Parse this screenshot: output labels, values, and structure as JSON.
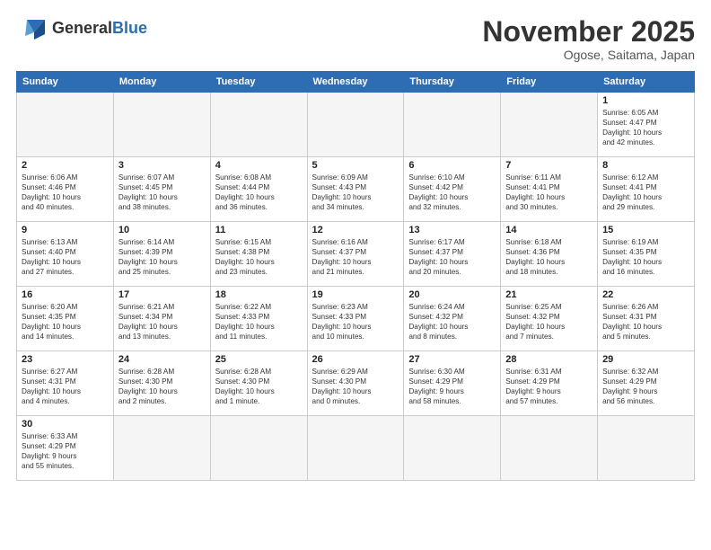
{
  "header": {
    "logo_general": "General",
    "logo_blue": "Blue",
    "month_title": "November 2025",
    "subtitle": "Ogose, Saitama, Japan"
  },
  "weekdays": [
    "Sunday",
    "Monday",
    "Tuesday",
    "Wednesday",
    "Thursday",
    "Friday",
    "Saturday"
  ],
  "weeks": [
    [
      {
        "day": "",
        "info": ""
      },
      {
        "day": "",
        "info": ""
      },
      {
        "day": "",
        "info": ""
      },
      {
        "day": "",
        "info": ""
      },
      {
        "day": "",
        "info": ""
      },
      {
        "day": "",
        "info": ""
      },
      {
        "day": "1",
        "info": "Sunrise: 6:05 AM\nSunset: 4:47 PM\nDaylight: 10 hours\nand 42 minutes."
      }
    ],
    [
      {
        "day": "2",
        "info": "Sunrise: 6:06 AM\nSunset: 4:46 PM\nDaylight: 10 hours\nand 40 minutes."
      },
      {
        "day": "3",
        "info": "Sunrise: 6:07 AM\nSunset: 4:45 PM\nDaylight: 10 hours\nand 38 minutes."
      },
      {
        "day": "4",
        "info": "Sunrise: 6:08 AM\nSunset: 4:44 PM\nDaylight: 10 hours\nand 36 minutes."
      },
      {
        "day": "5",
        "info": "Sunrise: 6:09 AM\nSunset: 4:43 PM\nDaylight: 10 hours\nand 34 minutes."
      },
      {
        "day": "6",
        "info": "Sunrise: 6:10 AM\nSunset: 4:42 PM\nDaylight: 10 hours\nand 32 minutes."
      },
      {
        "day": "7",
        "info": "Sunrise: 6:11 AM\nSunset: 4:41 PM\nDaylight: 10 hours\nand 30 minutes."
      },
      {
        "day": "8",
        "info": "Sunrise: 6:12 AM\nSunset: 4:41 PM\nDaylight: 10 hours\nand 29 minutes."
      }
    ],
    [
      {
        "day": "9",
        "info": "Sunrise: 6:13 AM\nSunset: 4:40 PM\nDaylight: 10 hours\nand 27 minutes."
      },
      {
        "day": "10",
        "info": "Sunrise: 6:14 AM\nSunset: 4:39 PM\nDaylight: 10 hours\nand 25 minutes."
      },
      {
        "day": "11",
        "info": "Sunrise: 6:15 AM\nSunset: 4:38 PM\nDaylight: 10 hours\nand 23 minutes."
      },
      {
        "day": "12",
        "info": "Sunrise: 6:16 AM\nSunset: 4:37 PM\nDaylight: 10 hours\nand 21 minutes."
      },
      {
        "day": "13",
        "info": "Sunrise: 6:17 AM\nSunset: 4:37 PM\nDaylight: 10 hours\nand 20 minutes."
      },
      {
        "day": "14",
        "info": "Sunrise: 6:18 AM\nSunset: 4:36 PM\nDaylight: 10 hours\nand 18 minutes."
      },
      {
        "day": "15",
        "info": "Sunrise: 6:19 AM\nSunset: 4:35 PM\nDaylight: 10 hours\nand 16 minutes."
      }
    ],
    [
      {
        "day": "16",
        "info": "Sunrise: 6:20 AM\nSunset: 4:35 PM\nDaylight: 10 hours\nand 14 minutes."
      },
      {
        "day": "17",
        "info": "Sunrise: 6:21 AM\nSunset: 4:34 PM\nDaylight: 10 hours\nand 13 minutes."
      },
      {
        "day": "18",
        "info": "Sunrise: 6:22 AM\nSunset: 4:33 PM\nDaylight: 10 hours\nand 11 minutes."
      },
      {
        "day": "19",
        "info": "Sunrise: 6:23 AM\nSunset: 4:33 PM\nDaylight: 10 hours\nand 10 minutes."
      },
      {
        "day": "20",
        "info": "Sunrise: 6:24 AM\nSunset: 4:32 PM\nDaylight: 10 hours\nand 8 minutes."
      },
      {
        "day": "21",
        "info": "Sunrise: 6:25 AM\nSunset: 4:32 PM\nDaylight: 10 hours\nand 7 minutes."
      },
      {
        "day": "22",
        "info": "Sunrise: 6:26 AM\nSunset: 4:31 PM\nDaylight: 10 hours\nand 5 minutes."
      }
    ],
    [
      {
        "day": "23",
        "info": "Sunrise: 6:27 AM\nSunset: 4:31 PM\nDaylight: 10 hours\nand 4 minutes."
      },
      {
        "day": "24",
        "info": "Sunrise: 6:28 AM\nSunset: 4:30 PM\nDaylight: 10 hours\nand 2 minutes."
      },
      {
        "day": "25",
        "info": "Sunrise: 6:28 AM\nSunset: 4:30 PM\nDaylight: 10 hours\nand 1 minute."
      },
      {
        "day": "26",
        "info": "Sunrise: 6:29 AM\nSunset: 4:30 PM\nDaylight: 10 hours\nand 0 minutes."
      },
      {
        "day": "27",
        "info": "Sunrise: 6:30 AM\nSunset: 4:29 PM\nDaylight: 9 hours\nand 58 minutes."
      },
      {
        "day": "28",
        "info": "Sunrise: 6:31 AM\nSunset: 4:29 PM\nDaylight: 9 hours\nand 57 minutes."
      },
      {
        "day": "29",
        "info": "Sunrise: 6:32 AM\nSunset: 4:29 PM\nDaylight: 9 hours\nand 56 minutes."
      }
    ],
    [
      {
        "day": "30",
        "info": "Sunrise: 6:33 AM\nSunset: 4:29 PM\nDaylight: 9 hours\nand 55 minutes."
      },
      {
        "day": "",
        "info": ""
      },
      {
        "day": "",
        "info": ""
      },
      {
        "day": "",
        "info": ""
      },
      {
        "day": "",
        "info": ""
      },
      {
        "day": "",
        "info": ""
      },
      {
        "day": "",
        "info": ""
      }
    ]
  ]
}
